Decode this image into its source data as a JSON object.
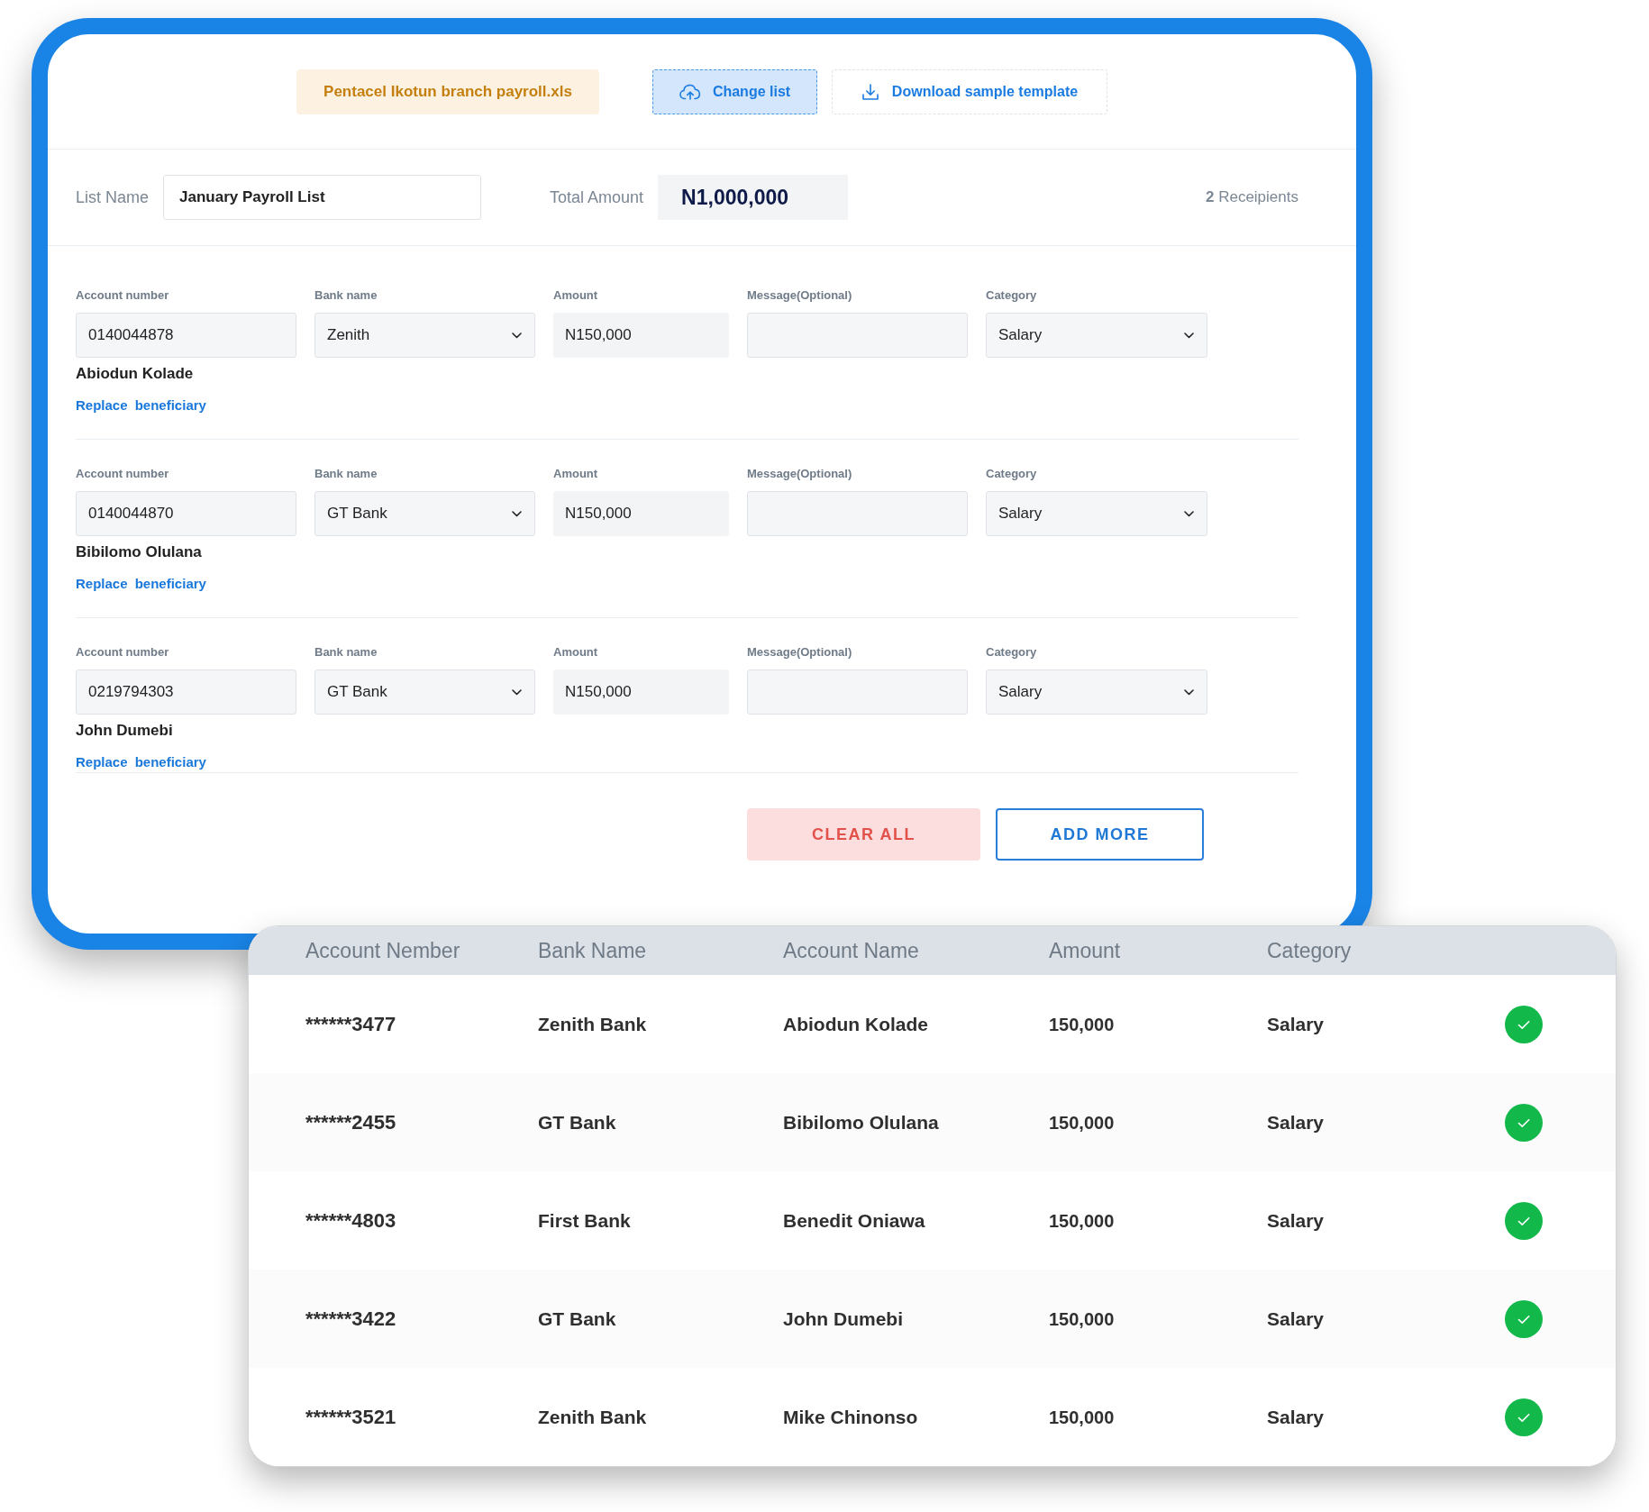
{
  "upload_bar": {
    "file_name": "Pentacel Ikotun branch payroll.xls",
    "buttons": [
      {
        "kind": "upload",
        "label": "Change list"
      },
      {
        "kind": "download",
        "label": "Download sample template"
      }
    ]
  },
  "list_info": {
    "name_label": "List Name",
    "name_value": "January Payroll List",
    "total_label": "Total Amount",
    "total_value": "N1,000,000",
    "recipients": "**2** Receipients"
  },
  "beneficiaries": [
    {
      "fields": [
        {
          "kind": "text",
          "label": "Account number",
          "value": "0140044878"
        },
        {
          "kind": "select",
          "label": "Bank name",
          "value": "Zenith"
        },
        {
          "kind": "amount",
          "label": "Amount",
          "value": "N150,000"
        },
        {
          "kind": "text",
          "label": "Message(Optional)"
        },
        {
          "kind": "select",
          "label": "Category",
          "value": "Salary"
        }
      ],
      "account_name": "Abiodun Kolade",
      "link": "Replace beneficiary"
    },
    {
      "fields": [
        {
          "kind": "text",
          "label": "Account number",
          "value": "0140044870"
        },
        {
          "kind": "select",
          "label": "Bank name",
          "value": "GT Bank"
        },
        {
          "kind": "amount",
          "label": "Amount",
          "value": "N150,000"
        },
        {
          "kind": "text",
          "label": "Message(Optional)"
        },
        {
          "kind": "select",
          "label": "Category",
          "value": "Salary"
        }
      ],
      "account_name": "Bibilomo Olulana",
      "link": "Replace beneficiary"
    },
    {
      "fields": [
        {
          "kind": "text",
          "label": "Account number",
          "value": "0219794303"
        },
        {
          "kind": "select",
          "label": "Bank name",
          "value": "GT Bank"
        },
        {
          "kind": "amount",
          "label": "Amount",
          "value": "N150,000"
        },
        {
          "kind": "text",
          "label": "Message(Optional)"
        },
        {
          "kind": "select",
          "label": "Category",
          "value": "Salary"
        }
      ],
      "account_name": "John Dumebi",
      "link": "Replace beneficiary"
    }
  ],
  "actions": [
    {
      "kind": "clear",
      "label": "CLEAR ALL"
    },
    {
      "kind": "add",
      "label": "ADD MORE"
    }
  ],
  "table": {
    "columns": [
      "Account Nember",
      "Bank Name",
      "Account Name",
      "Amount",
      "Category"
    ],
    "rows": [
      {
        "account": "******3477",
        "bank": "Zenith Bank",
        "name": "Abiodun Kolade",
        "amount": "150,000",
        "category": "Salary",
        "verified": true
      },
      {
        "account": "******2455",
        "bank": "GT Bank",
        "name": "Bibilomo Olulana",
        "amount": "150,000",
        "category": "Salary",
        "verified": true
      },
      {
        "account": "******4803",
        "bank": "First Bank",
        "name": "Benedit Oniawa",
        "amount": "150,000",
        "category": "Salary",
        "verified": true
      },
      {
        "account": "******3422",
        "bank": "GT Bank",
        "name": "John Dumebi",
        "amount": "150,000",
        "category": "Salary",
        "verified": true
      },
      {
        "account": "******3521",
        "bank": "Zenith Bank",
        "name": "Mike Chinonso",
        "amount": "150,000",
        "category": "Salary",
        "verified": true
      }
    ]
  }
}
